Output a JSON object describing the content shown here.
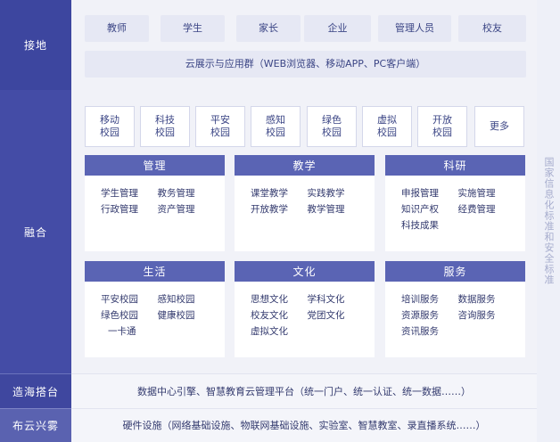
{
  "layers": {
    "jiedi": "接地",
    "ronghe": "融合",
    "zaohai": "造海搭台",
    "buyun": "布云兴雾"
  },
  "roles": [
    "教师",
    "学生",
    "家长",
    "企业",
    "管理人员",
    "校友"
  ],
  "cloud_banner": "云展示与应用群（WEB浏览器、移动APP、PC客户端）",
  "campus_tiles": [
    "移动\n校园",
    "科技\n校园",
    "平安\n校园",
    "感知\n校园",
    "绿色\n校园",
    "虚拟\n校园",
    "开放\n校园",
    "更多"
  ],
  "blocks": [
    {
      "title": "管理",
      "items": [
        "学生管理",
        "教务管理",
        "行政管理",
        "资产管理"
      ]
    },
    {
      "title": "教学",
      "items": [
        "课堂教学",
        "实践教学",
        "开放教学",
        "教学管理"
      ]
    },
    {
      "title": "科研",
      "items": [
        "申报管理",
        "实施管理",
        "知识产权",
        "经费管理",
        "科技成果"
      ]
    },
    {
      "title": "生活",
      "items": [
        "平安校园",
        "感知校园",
        "绿色校园",
        "健康校园",
        "一卡通"
      ]
    },
    {
      "title": "文化",
      "items": [
        "思想文化",
        "学科文化",
        "校友文化",
        "党团文化",
        "虚拟文化"
      ]
    },
    {
      "title": "服务",
      "items": [
        "培训服务",
        "数据服务",
        "资源服务",
        "咨询服务",
        "资讯服务"
      ]
    }
  ],
  "platform_text": "数据中心引擎、智慧教育云管理平台（统一门户、统一认证、统一数据……）",
  "infra_text": "硬件设施（网络基础设施、物联网基础设施、实验室、智慧教室、录直播系统……）",
  "side_label": "国家信息化标准和安全标准",
  "colors": {
    "layer_top": "#3d469f",
    "layer_mid": "#474fa8",
    "layer_low": "#5a62b0",
    "block_head": "#5a64b4",
    "panel": "#f1f2f8"
  }
}
